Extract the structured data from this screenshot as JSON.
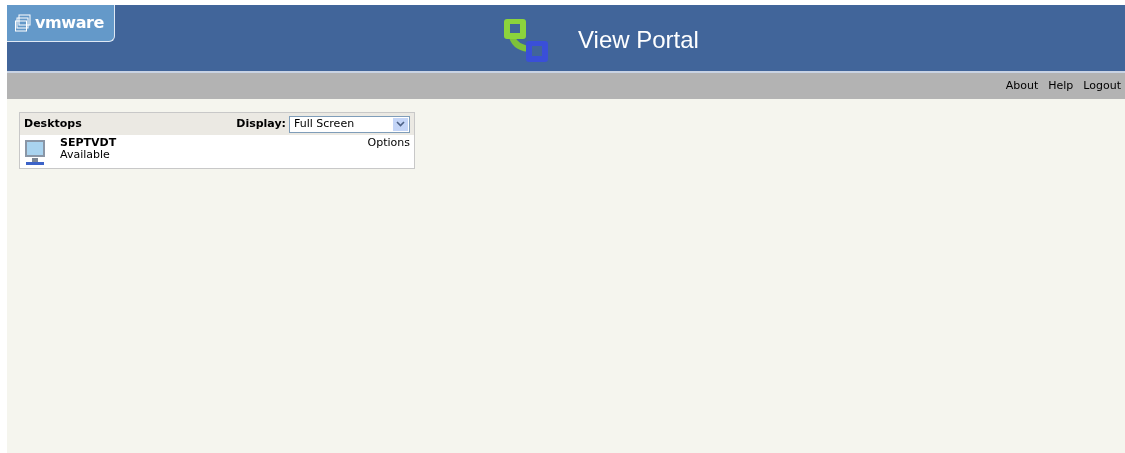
{
  "header": {
    "logo": "vmware",
    "title": "View Portal"
  },
  "nav_links": [
    "About",
    "Help",
    "Logout"
  ],
  "desktops_panel": {
    "heading": "Desktops",
    "display_label": "Display:",
    "display_value": "Full Screen",
    "desktops": [
      {
        "name": "SEPTVDT",
        "status": "Available",
        "options": "Options"
      }
    ]
  }
}
